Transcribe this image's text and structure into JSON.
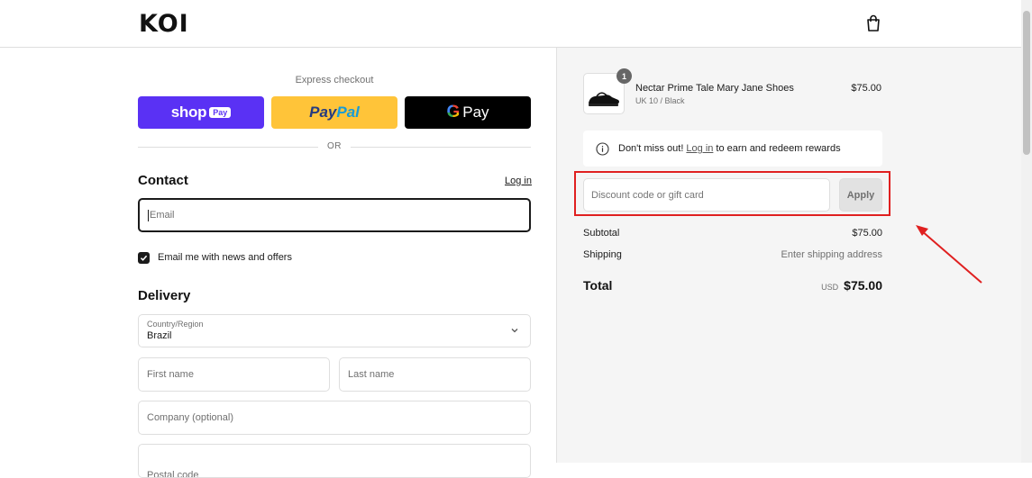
{
  "brand": {
    "logo": "KOI"
  },
  "header": {
    "cart_icon": "shopping-bag-icon"
  },
  "express": {
    "label": "Express checkout",
    "shop_pay": {
      "word": "shop",
      "pill": "Pay"
    },
    "paypal": {
      "part1": "Pay",
      "part2": "Pal"
    },
    "gpay": {
      "g": "G",
      "pay": "Pay"
    },
    "divider": "OR"
  },
  "contact": {
    "title": "Contact",
    "login_link": "Log in",
    "email_placeholder": "Email",
    "newsletter_label": "Email me with news and offers",
    "newsletter_checked": true
  },
  "delivery": {
    "title": "Delivery",
    "country_label": "Country/Region",
    "country_value": "Brazil",
    "first_name_placeholder": "First name",
    "last_name_placeholder": "Last name",
    "company_placeholder": "Company (optional)",
    "postal_placeholder": "Postal code"
  },
  "cart": {
    "item": {
      "quantity": "1",
      "name": "Nectar Prime Tale Mary Jane Shoes",
      "variant": "UK 10 / Black",
      "price": "$75.00"
    },
    "rewards": {
      "prefix": "Don't miss out!",
      "link": "Log in",
      "suffix": "to earn and redeem rewards"
    },
    "discount": {
      "placeholder": "Discount code or gift card",
      "apply_label": "Apply"
    },
    "summary": {
      "subtotal_label": "Subtotal",
      "subtotal_value": "$75.00",
      "shipping_label": "Shipping",
      "shipping_value": "Enter shipping address",
      "total_label": "Total",
      "total_currency": "USD",
      "total_value": "$75.00"
    }
  },
  "colors": {
    "shop_pay": "#5a31f4",
    "paypal": "#ffc439",
    "gpay": "#000000",
    "highlight": "#e02020"
  }
}
